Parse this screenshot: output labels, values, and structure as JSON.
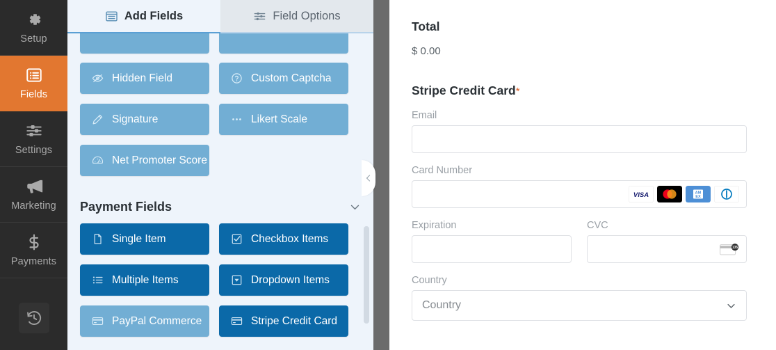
{
  "sidebar": {
    "items": [
      {
        "label": "Setup",
        "icon": "gear-icon",
        "active": false
      },
      {
        "label": "Fields",
        "icon": "list-icon",
        "active": true
      },
      {
        "label": "Settings",
        "icon": "sliders-icon",
        "active": false
      },
      {
        "label": "Marketing",
        "icon": "megaphone-icon",
        "active": false
      },
      {
        "label": "Payments",
        "icon": "dollar-icon",
        "active": false
      }
    ],
    "revision_icon": "revision-history-icon",
    "active_color": "#e27730",
    "background": "#2b2b2b"
  },
  "panel": {
    "tabs": [
      {
        "label": "Add Fields",
        "icon": "fields-grid-icon",
        "active": true
      },
      {
        "label": "Field Options",
        "icon": "field-options-icon",
        "active": false
      }
    ],
    "standard_fields": [
      {
        "label": "Hidden Field",
        "icon": "eye-slash-icon",
        "state": "muted"
      },
      {
        "label": "Custom Captcha",
        "icon": "question-mark-icon",
        "state": "muted"
      },
      {
        "label": "Signature",
        "icon": "pencil-icon",
        "state": "muted"
      },
      {
        "label": "Likert Scale",
        "icon": "dots-icon",
        "state": "muted"
      },
      {
        "label": "Net Promoter Score",
        "icon": "gauge-icon",
        "state": "muted"
      }
    ],
    "payment_section": {
      "title": "Payment Fields",
      "collapse_icon": "chevron-down-icon",
      "fields": [
        {
          "label": "Single Item",
          "icon": "file-icon",
          "state": "active"
        },
        {
          "label": "Checkbox Items",
          "icon": "checkbox-icon",
          "state": "active"
        },
        {
          "label": "Multiple Items",
          "icon": "bullet-list-icon",
          "state": "active"
        },
        {
          "label": "Dropdown Items",
          "icon": "dropdown-icon",
          "state": "active"
        },
        {
          "label": "PayPal Commerce",
          "icon": "credit-card-icon",
          "state": "muted"
        },
        {
          "label": "Stripe Credit Card",
          "icon": "credit-card-icon",
          "state": "active"
        }
      ]
    },
    "collapse_handle_icon": "chevron-left-icon",
    "button_color": "#0b69a8",
    "button_muted_color": "#72aed4"
  },
  "preview": {
    "total_label": "Total",
    "total_value": "$ 0.00",
    "stripe_heading": "Stripe Credit Card",
    "required_marker": "*",
    "email_label": "Email",
    "email_value": "",
    "card_number_label": "Card Number",
    "card_number_value": "",
    "card_brands": [
      "visa-icon",
      "mastercard-icon",
      "amex-icon",
      "diners-club-icon"
    ],
    "expiration_label": "Expiration",
    "expiration_value": "",
    "cvc_label": "CVC",
    "cvc_value": "",
    "cvc_icon": "card-cvc-135-icon",
    "country_label": "Country",
    "country_selected": "Country",
    "country_chevron_icon": "chevron-down-icon"
  }
}
